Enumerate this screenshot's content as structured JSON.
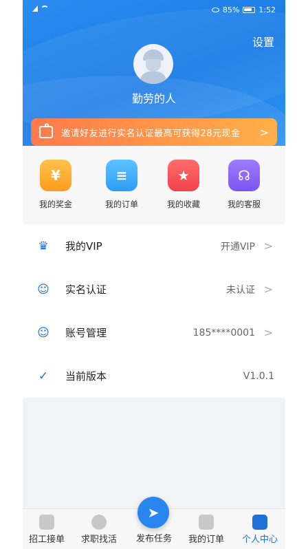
{
  "status_bar": {
    "battery": "85%",
    "time": "1:52"
  },
  "header": {
    "settings_label": "设置",
    "username": "勤劳的人"
  },
  "banner": {
    "text": "邀请好友进行实名认证最高可获得28元现金",
    "chevron": ">"
  },
  "quick_actions": [
    {
      "label": "我的奖金",
      "icon": "money-bag-icon",
      "glyph": "¥"
    },
    {
      "label": "我的订单",
      "icon": "clipboard-icon",
      "glyph": "≡"
    },
    {
      "label": "我的收藏",
      "icon": "star-icon",
      "glyph": "★"
    },
    {
      "label": "我的客服",
      "icon": "headset-icon",
      "glyph": "☊"
    }
  ],
  "menu": [
    {
      "title": "我的VIP",
      "value": "开通VIP",
      "icon": "crown-icon",
      "glyph": "♛",
      "chevron": ">"
    },
    {
      "title": "实名认证",
      "value": "未认证",
      "icon": "user-check-icon",
      "glyph": "☺",
      "chevron": ">"
    },
    {
      "title": "账号管理",
      "value": "185****0001",
      "icon": "user-manage-icon",
      "glyph": "☺",
      "chevron": ">"
    },
    {
      "title": "当前版本",
      "value": "V1.0.1",
      "icon": "shield-check-icon",
      "glyph": "✓"
    }
  ],
  "bottom_nav": [
    {
      "label": "招工接单",
      "icon": "worker-icon"
    },
    {
      "label": "求职找活",
      "icon": "search-plus-icon"
    },
    {
      "label": "发布任务",
      "icon": "send-icon",
      "glyph": "➤"
    },
    {
      "label": "我的订单",
      "icon": "order-icon"
    },
    {
      "label": "个人中心",
      "icon": "profile-icon",
      "active": true
    }
  ],
  "colors": {
    "primary": "#1f6fd6",
    "banner_start": "#ff7a4a",
    "banner_end": "#ffb04a"
  }
}
